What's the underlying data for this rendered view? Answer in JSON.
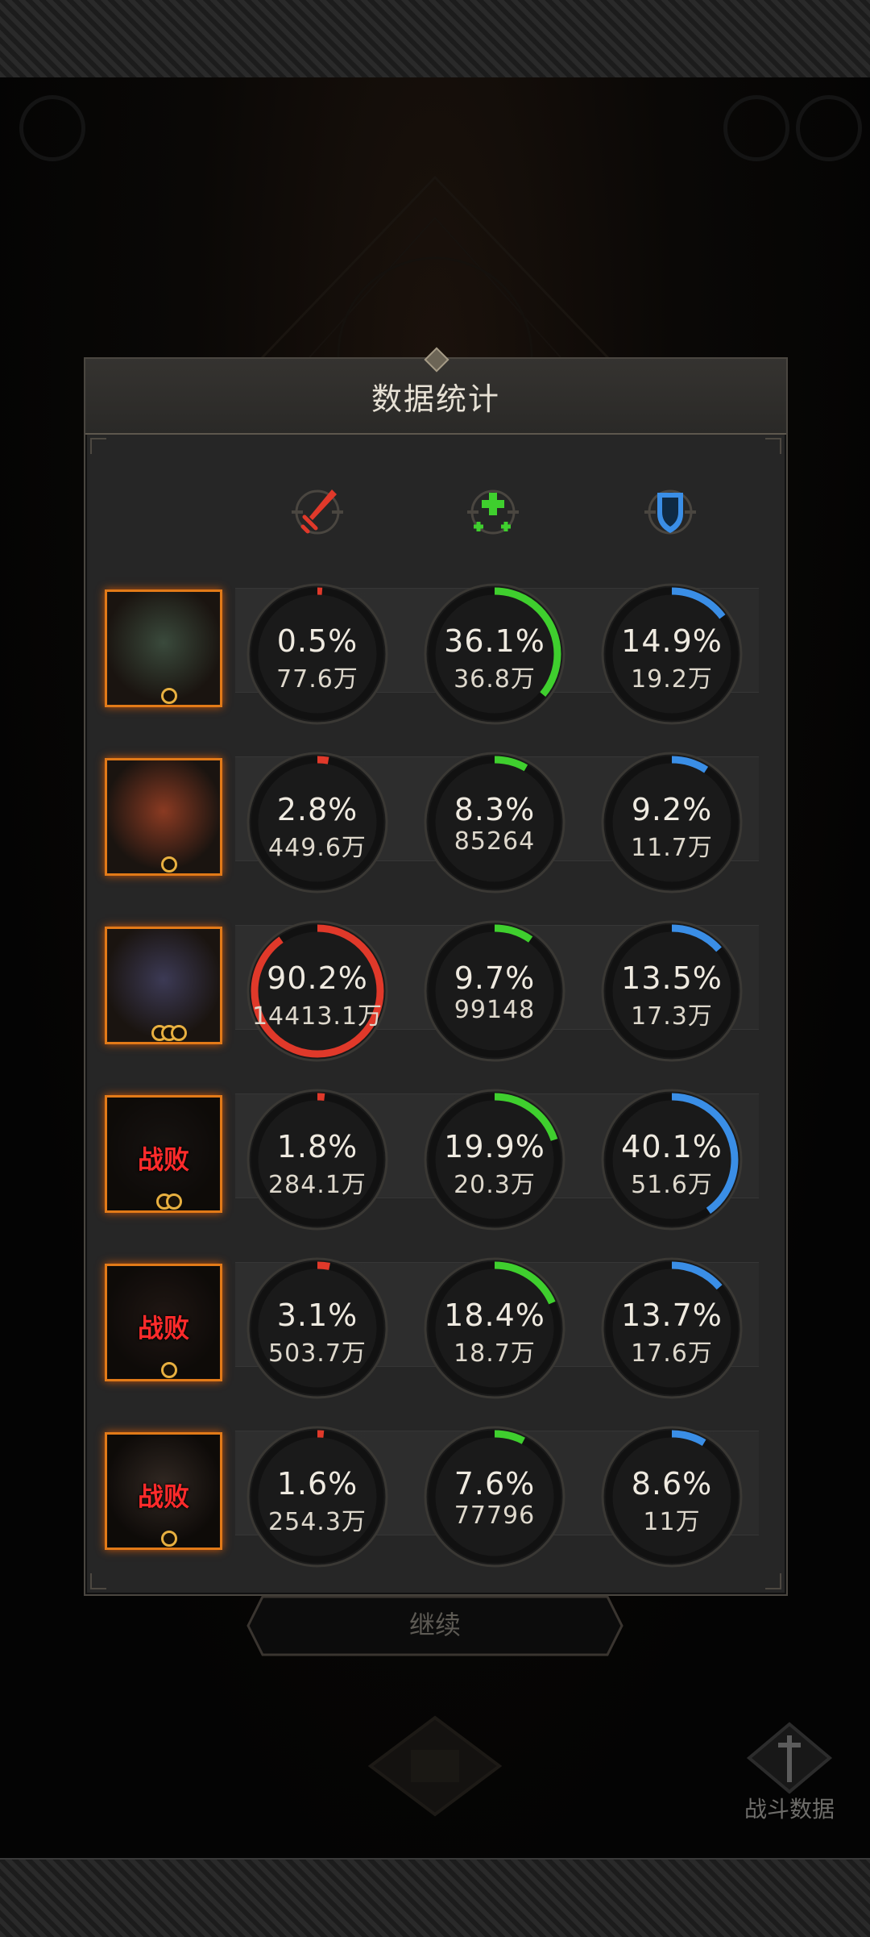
{
  "panel": {
    "title": "数据统计"
  },
  "columns": [
    {
      "icon": "sword-damage-icon",
      "color": "#e0392a"
    },
    {
      "icon": "healing-cross-icon",
      "color": "#3fcf2e"
    },
    {
      "icon": "shield-defense-icon",
      "color": "#3a8ee6"
    }
  ],
  "heroes": [
    {
      "name": "hero-1",
      "defeated": false,
      "defeat_label": "",
      "stars": 1,
      "damage": {
        "percent": "0.5%",
        "amount": "77.6万",
        "fraction": 0.005
      },
      "heal": {
        "percent": "36.1%",
        "amount": "36.8万",
        "fraction": 0.361
      },
      "tank": {
        "percent": "14.9%",
        "amount": "19.2万",
        "fraction": 0.149
      }
    },
    {
      "name": "hero-2",
      "defeated": false,
      "defeat_label": "",
      "stars": 1,
      "damage": {
        "percent": "2.8%",
        "amount": "449.6万",
        "fraction": 0.028
      },
      "heal": {
        "percent": "8.3%",
        "amount": "85264",
        "fraction": 0.083
      },
      "tank": {
        "percent": "9.2%",
        "amount": "11.7万",
        "fraction": 0.092
      }
    },
    {
      "name": "hero-3",
      "defeated": false,
      "defeat_label": "",
      "stars": 3,
      "damage": {
        "percent": "90.2%",
        "amount": "14413.1万",
        "fraction": 0.902
      },
      "heal": {
        "percent": "9.7%",
        "amount": "99148",
        "fraction": 0.097
      },
      "tank": {
        "percent": "13.5%",
        "amount": "17.3万",
        "fraction": 0.135
      }
    },
    {
      "name": "hero-4",
      "defeated": true,
      "defeat_label": "战败",
      "stars": 2,
      "damage": {
        "percent": "1.8%",
        "amount": "284.1万",
        "fraction": 0.018
      },
      "heal": {
        "percent": "19.9%",
        "amount": "20.3万",
        "fraction": 0.199
      },
      "tank": {
        "percent": "40.1%",
        "amount": "51.6万",
        "fraction": 0.401
      }
    },
    {
      "name": "hero-5",
      "defeated": true,
      "defeat_label": "战败",
      "stars": 1,
      "damage": {
        "percent": "3.1%",
        "amount": "503.7万",
        "fraction": 0.031
      },
      "heal": {
        "percent": "18.4%",
        "amount": "18.7万",
        "fraction": 0.184
      },
      "tank": {
        "percent": "13.7%",
        "amount": "17.6万",
        "fraction": 0.137
      }
    },
    {
      "name": "hero-6",
      "defeated": true,
      "defeat_label": "战败",
      "stars": 1,
      "damage": {
        "percent": "1.6%",
        "amount": "254.3万",
        "fraction": 0.016
      },
      "heal": {
        "percent": "7.6%",
        "amount": "77796",
        "fraction": 0.076
      },
      "tank": {
        "percent": "8.6%",
        "amount": "11万",
        "fraction": 0.086
      }
    }
  ],
  "continue_label": "继续",
  "battle_data_label": "战斗数据",
  "avatar_colors": [
    "#3a4a3c",
    "#8a3a22",
    "#3c3a55",
    "#2a2420",
    "#3a2a24",
    "#5a4a40"
  ]
}
